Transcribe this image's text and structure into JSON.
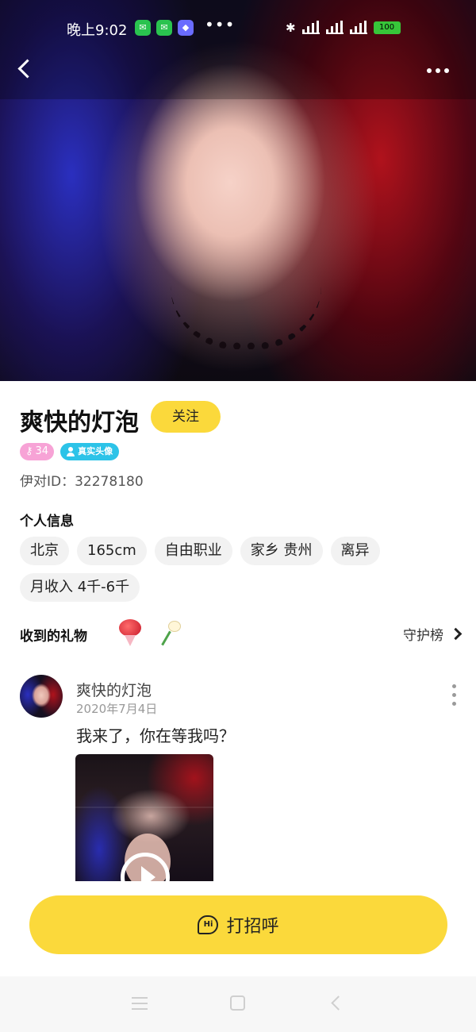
{
  "status_bar": {
    "time": "晚上9:02",
    "battery": "100",
    "overflow_dots": "•••"
  },
  "profile": {
    "name": "爽快的灯泡",
    "follow_label": "关注",
    "level": "34",
    "verified_label": "真实头像",
    "id_label": "伊对ID：",
    "id_value": "32278180"
  },
  "personal_info": {
    "title": "个人信息",
    "tags": [
      "北京",
      "165cm",
      "自由职业",
      "家乡 贵州",
      "离异",
      "月收入 4千-6千"
    ]
  },
  "gifts": {
    "title": "收到的礼物",
    "items": [
      "rose-bouquet-icon",
      "white-rose-icon"
    ],
    "guard_link": "守护榜"
  },
  "post": {
    "author": "爽快的灯泡",
    "date": "2020年7月4日",
    "text": "我来了，你在等我吗？"
  },
  "cta": {
    "greet_label": "打招呼",
    "hi_icon_text": "Hi"
  },
  "colors": {
    "accent_yellow": "#fbd93b",
    "level_pink": "#f7a3d6",
    "verified_cyan": "#2cc3e8"
  }
}
